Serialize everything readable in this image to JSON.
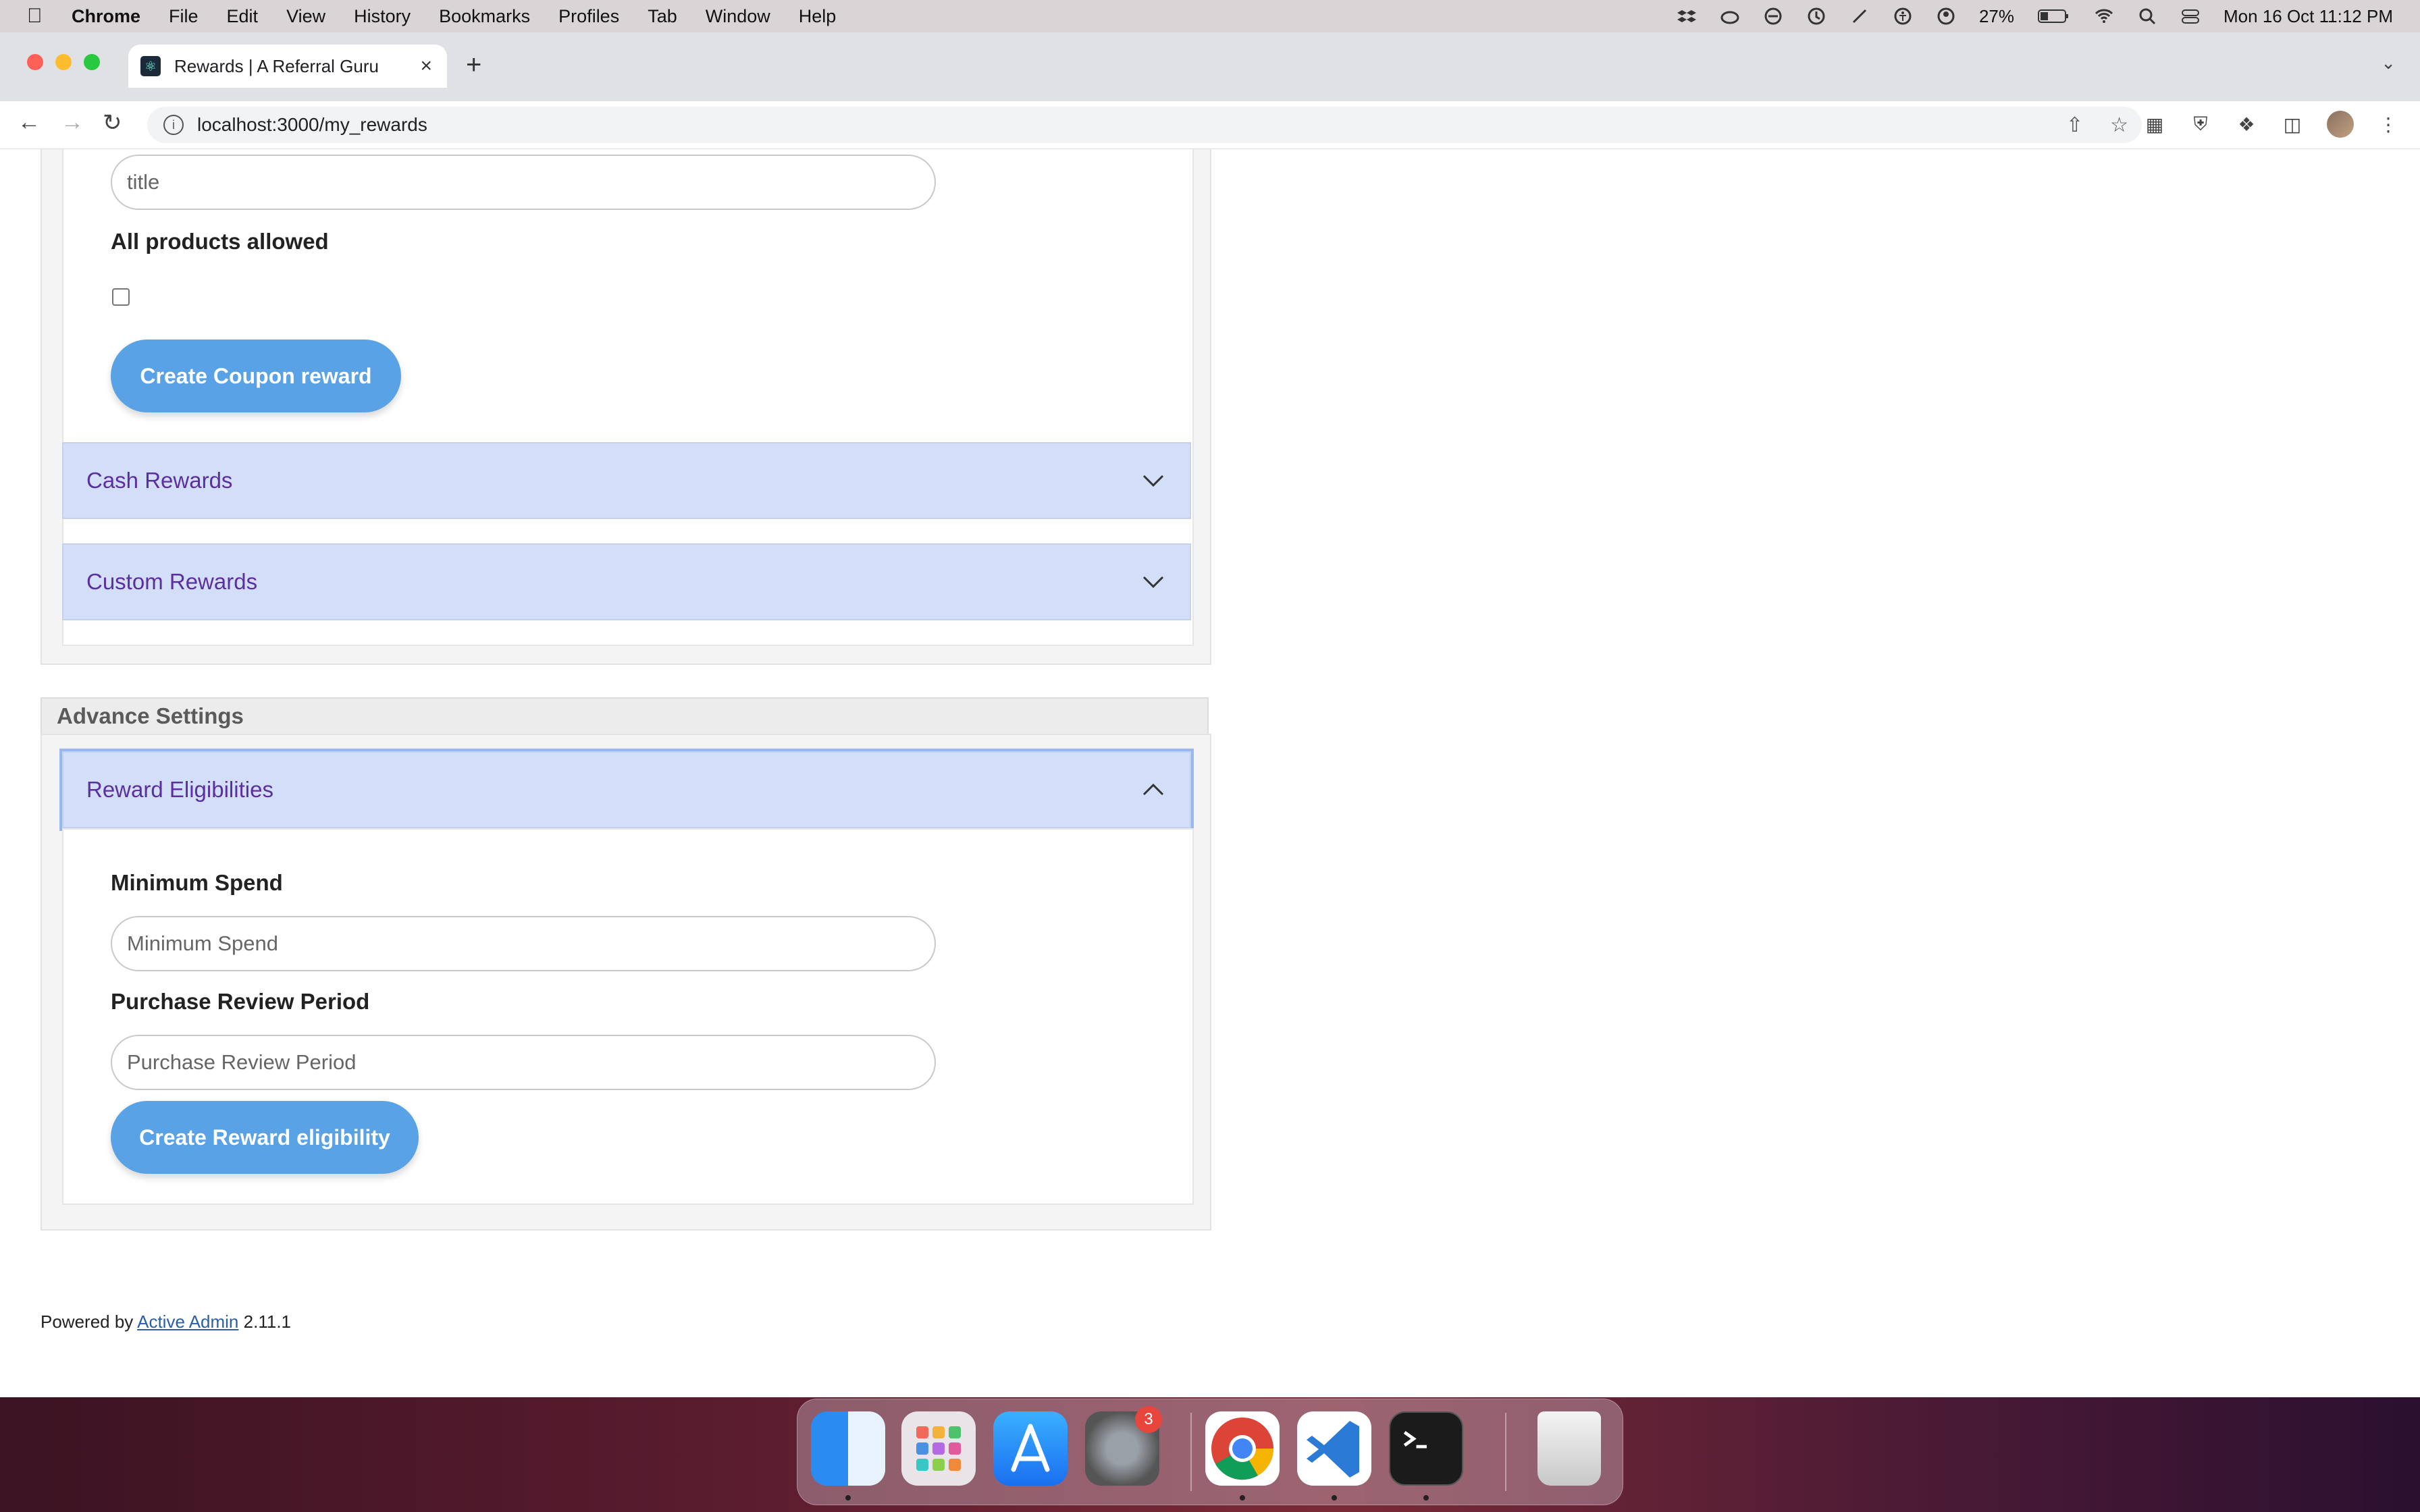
{
  "menubar": {
    "app_name": "Chrome",
    "items": [
      "File",
      "Edit",
      "View",
      "History",
      "Bookmarks",
      "Profiles",
      "Tab",
      "Window",
      "Help"
    ],
    "battery": "27%",
    "datetime": "Mon 16 Oct  11:12 PM"
  },
  "browser": {
    "tab_title": "Rewards | A Referral Guru",
    "url_host": "localhost",
    "url_rest": ":3000/my_rewards"
  },
  "coupon_form": {
    "title_placeholder": "title",
    "all_products_label": "All products allowed",
    "all_products_checked": false,
    "submit_label": "Create Coupon reward"
  },
  "accordions": {
    "cash_rewards": "Cash Rewards",
    "custom_rewards": "Custom Rewards"
  },
  "advance_settings": {
    "heading": "Advance Settings",
    "eligibilities_label": "Reward Eligibilities",
    "min_spend_label": "Minimum Spend",
    "min_spend_placeholder": "Minimum Spend",
    "review_period_label": "Purchase Review Period",
    "review_period_placeholder": "Purchase Review Period",
    "submit_label": "Create Reward eligibility"
  },
  "footer": {
    "prefix": "Powered by",
    "link_text": "Active Admin",
    "version": "2.11.1"
  },
  "dock": {
    "settings_badge": "3"
  },
  "colors": {
    "button": "#5aa2e6",
    "accordion_bg": "#d3dff8",
    "accordion_text": "#5b2fa0"
  }
}
